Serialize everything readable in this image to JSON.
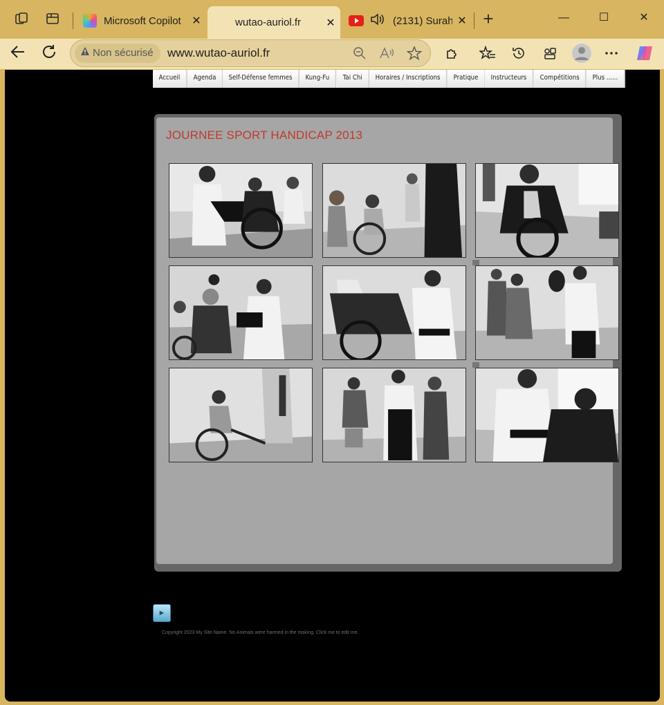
{
  "tabs": [
    {
      "title": "Microsoft Copilot",
      "close": "✕"
    },
    {
      "title": "wutao-auriol.fr",
      "close": "✕"
    },
    {
      "title": "(2131) Surah",
      "close": "✕"
    }
  ],
  "new_tab": "+",
  "window_controls": {
    "minimize": "—",
    "maximize": "☐",
    "close": "✕"
  },
  "address_bar": {
    "security_label": "Non sécurisé",
    "url": "www.wutao-auriol.fr"
  },
  "site_nav": [
    "Accueil",
    "Agenda",
    "Self-Défense femmes",
    "Kung-Fu",
    "Tai Chi",
    "Horaires / Inscriptions",
    "Pratique",
    "Instructeurs",
    "Compétitions",
    "Plus ......"
  ],
  "page": {
    "title": "JOURNEE SPORT HANDICAP 2013",
    "play_symbol": "►",
    "footer": "Copyright 2023 My Site Name. No Animals were harmed in the making. Click me to edit me."
  },
  "colors": {
    "title_red": "#c0392b",
    "panel_gray": "#a6a6a6",
    "chrome_gold": "#d8b560"
  }
}
